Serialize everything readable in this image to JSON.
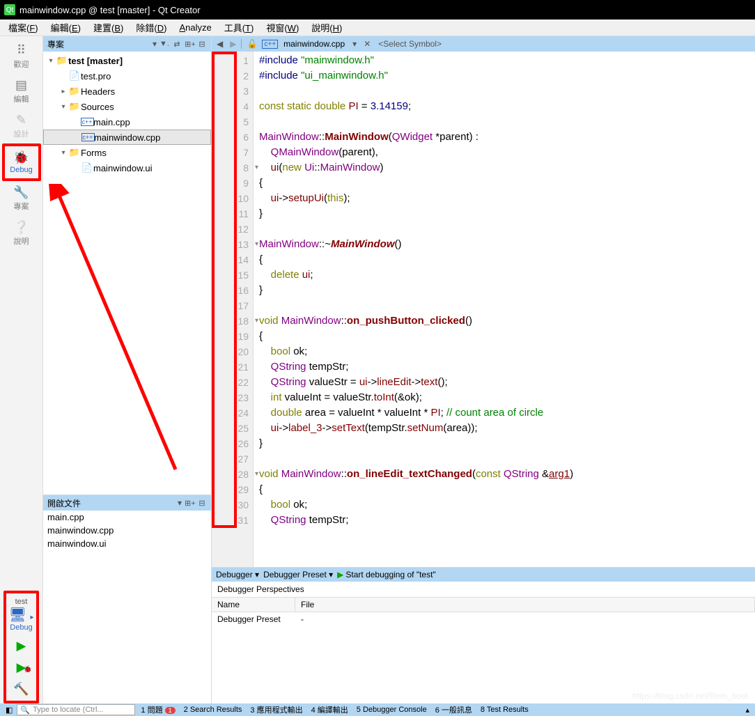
{
  "window": {
    "title": "mainwindow.cpp @ test [master] - Qt Creator"
  },
  "menu": [
    "檔案(F)",
    "編輯(E)",
    "建置(B)",
    "除錯(D)",
    "Analyze",
    "工具(T)",
    "視窗(W)",
    "說明(H)"
  ],
  "leftbar": {
    "items": [
      {
        "label": "歡迎",
        "icon": "⊞"
      },
      {
        "label": "編輯",
        "icon": "≣"
      },
      {
        "label": "設計",
        "icon": "✎"
      },
      {
        "label": "Debug",
        "icon": "🐞"
      },
      {
        "label": "專案",
        "icon": "🔧"
      },
      {
        "label": "說明",
        "icon": "❔"
      }
    ],
    "target": {
      "name": "test",
      "config": "Debug"
    },
    "run": {
      "play": "▶",
      "debug": "🐞",
      "build": "🔨"
    }
  },
  "project_pane": {
    "title": "專案",
    "tree": [
      {
        "indent": 0,
        "tw": "▾",
        "icon": "📁",
        "label": "test [master]",
        "bold": true
      },
      {
        "indent": 1,
        "tw": "",
        "icon": "📄",
        "label": "test.pro"
      },
      {
        "indent": 1,
        "tw": "▸",
        "icon": "📁",
        "label": "Headers"
      },
      {
        "indent": 1,
        "tw": "▾",
        "icon": "📁",
        "label": "Sources"
      },
      {
        "indent": 2,
        "tw": "",
        "icon": "c++",
        "label": "main.cpp"
      },
      {
        "indent": 2,
        "tw": "",
        "icon": "c++",
        "label": "mainwindow.cpp",
        "sel": true
      },
      {
        "indent": 1,
        "tw": "▾",
        "icon": "📁",
        "label": "Forms"
      },
      {
        "indent": 2,
        "tw": "",
        "icon": "📄",
        "label": "mainwindow.ui"
      }
    ]
  },
  "openfiles": {
    "title": "開啟文件",
    "items": [
      "main.cpp",
      "mainwindow.cpp",
      "mainwindow.ui"
    ]
  },
  "editor_bar": {
    "file": "mainwindow.cpp",
    "symbol": "<Select Symbol>"
  },
  "code": {
    "lines": [
      {
        "n": 1,
        "html": "<span class='pp'>#include</span> <span class='str'>\"mainwindow.h\"</span>"
      },
      {
        "n": 2,
        "html": "<span class='pp'>#include</span> <span class='str'>\"ui_mainwindow.h\"</span>"
      },
      {
        "n": 3,
        "html": ""
      },
      {
        "n": 4,
        "html": "<span class='kw'>const</span> <span class='kw'>static</span> <span class='kw'>double</span> <span class='id'>PI</span> <span class='op'>=</span> <span class='num'>3.14159</span>;"
      },
      {
        "n": 5,
        "html": ""
      },
      {
        "n": 6,
        "html": "<span class='typ'>MainWindow</span>::<span class='fn2'>MainWindow</span>(<span class='typ'>QWidget</span> *parent) :"
      },
      {
        "n": 7,
        "html": "    <span class='typ'>QMainWindow</span>(parent),"
      },
      {
        "n": 8,
        "fold": "▾",
        "html": "    <span class='id'>ui</span>(<span class='kw'>new</span> <span class='typ'>Ui</span>::<span class='typ'>MainWindow</span>)"
      },
      {
        "n": 9,
        "html": "{"
      },
      {
        "n": 10,
        "html": "    <span class='id'>ui</span>-><span class='id'>setupUi</span>(<span class='kw'>this</span>);"
      },
      {
        "n": 11,
        "html": "}"
      },
      {
        "n": 12,
        "html": ""
      },
      {
        "n": 13,
        "fold": "▾",
        "html": "<span class='typ'>MainWindow</span>::~<span class='fn'>MainWindow</span>()"
      },
      {
        "n": 14,
        "html": "{"
      },
      {
        "n": 15,
        "html": "    <span class='kw'>delete</span> <span class='id'>ui</span>;"
      },
      {
        "n": 16,
        "html": "}"
      },
      {
        "n": 17,
        "html": ""
      },
      {
        "n": 18,
        "fold": "▾",
        "html": "<span class='kw'>void</span> <span class='typ'>MainWindow</span>::<span class='fn2'>on_pushButton_clicked</span>()"
      },
      {
        "n": 19,
        "html": "{"
      },
      {
        "n": 20,
        "html": "    <span class='kw'>bool</span> ok;"
      },
      {
        "n": 21,
        "html": "    <span class='typ'>QString</span> tempStr;"
      },
      {
        "n": 22,
        "html": "    <span class='typ'>QString</span> valueStr <span class='op'>=</span> <span class='id'>ui</span>-><span class='id'>lineEdit</span>-><span class='id'>text</span>();"
      },
      {
        "n": 23,
        "html": "    <span class='kw'>int</span> valueInt <span class='op'>=</span> valueStr.<span class='id'>toInt</span>(&ok);"
      },
      {
        "n": 24,
        "html": "    <span class='kw'>double</span> area <span class='op'>=</span> valueInt <span class='op'>*</span> valueInt <span class='op'>*</span> <span class='id'>PI</span>; <span class='cm'>// count area of circle</span>"
      },
      {
        "n": 25,
        "html": "    <span class='id'>ui</span>-><span class='id'>label_3</span>-><span class='id'>setText</span>(tempStr.<span class='id'>setNum</span>(area));"
      },
      {
        "n": 26,
        "html": "}"
      },
      {
        "n": 27,
        "html": ""
      },
      {
        "n": 28,
        "fold": "▾",
        "warn": true,
        "html": "<span class='kw'>void</span> <span class='typ'>MainWindow</span>::<span class='fn2'>on_lineEdit_textChanged</span>(<span class='kw'>const</span> <span class='typ'>QString</span> &<span class='arg'>arg1</span>)"
      },
      {
        "n": 29,
        "html": "{"
      },
      {
        "n": 30,
        "html": "    <span class='kw'>bool</span> ok;"
      },
      {
        "n": 31,
        "html": "    <span class='typ'>QString</span> tempStr;"
      }
    ]
  },
  "debugger": {
    "toolbar": {
      "a": "Debugger",
      "b": "Debugger Preset",
      "c": "Start debugging of \"test\""
    },
    "perspectives": "Debugger Perspectives",
    "cols": {
      "name": "Name",
      "file": "File"
    },
    "row": {
      "name": "Debugger Preset",
      "file": "-"
    }
  },
  "status": {
    "locator_ph": "Type to locate (Ctrl...",
    "tabs": [
      {
        "n": "1",
        "label": "問題",
        "badge": "1"
      },
      {
        "n": "2",
        "label": "Search Results"
      },
      {
        "n": "3",
        "label": "應用程式輸出"
      },
      {
        "n": "4",
        "label": "編譯輸出"
      },
      {
        "n": "5",
        "label": "Debugger Console"
      },
      {
        "n": "6",
        "label": "一般訊息"
      },
      {
        "n": "8",
        "label": "Test Results"
      }
    ]
  },
  "watermark": "https://blog.csdn.net/Rem_boot"
}
